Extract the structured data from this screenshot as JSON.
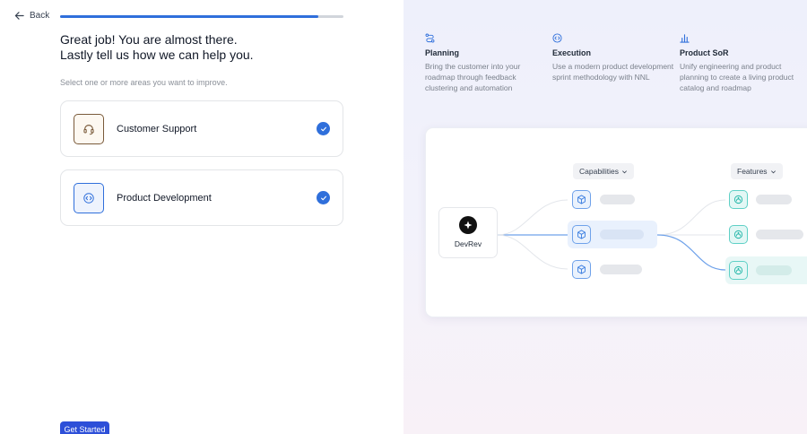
{
  "nav": {
    "back_label": "Back",
    "progress": 0.91
  },
  "heading": {
    "line1": "Great job! You are almost there.",
    "line2": "Lastly tell us how we can help you."
  },
  "subtitle": "Select one or more areas you want to improve.",
  "options": [
    {
      "label": "Customer Support",
      "icon": "headset-icon",
      "checked": true
    },
    {
      "label": "Product Development",
      "icon": "code-icon",
      "checked": true
    }
  ],
  "cta_label": "Get Started",
  "features": [
    {
      "icon": "route-icon",
      "title": "Planning",
      "description": "Bring the customer into your roadmap through feedback clustering and automation"
    },
    {
      "icon": "code-icon",
      "title": "Execution",
      "description": "Use a modern product development sprint methodology with NNL"
    },
    {
      "icon": "bar-chart-icon",
      "title": "Product SoR",
      "description": "Unify engineering and product planning to create a living product catalog and roadmap"
    }
  ],
  "diagram": {
    "capabilities_label": "Capabilities",
    "features_label": "Features",
    "root_label": "DevRev"
  },
  "colors": {
    "accent": "#2f6fdb",
    "cta": "#2d4fd8",
    "capability_node": "#6fa2ea",
    "feature_node": "#5fd0c6"
  }
}
